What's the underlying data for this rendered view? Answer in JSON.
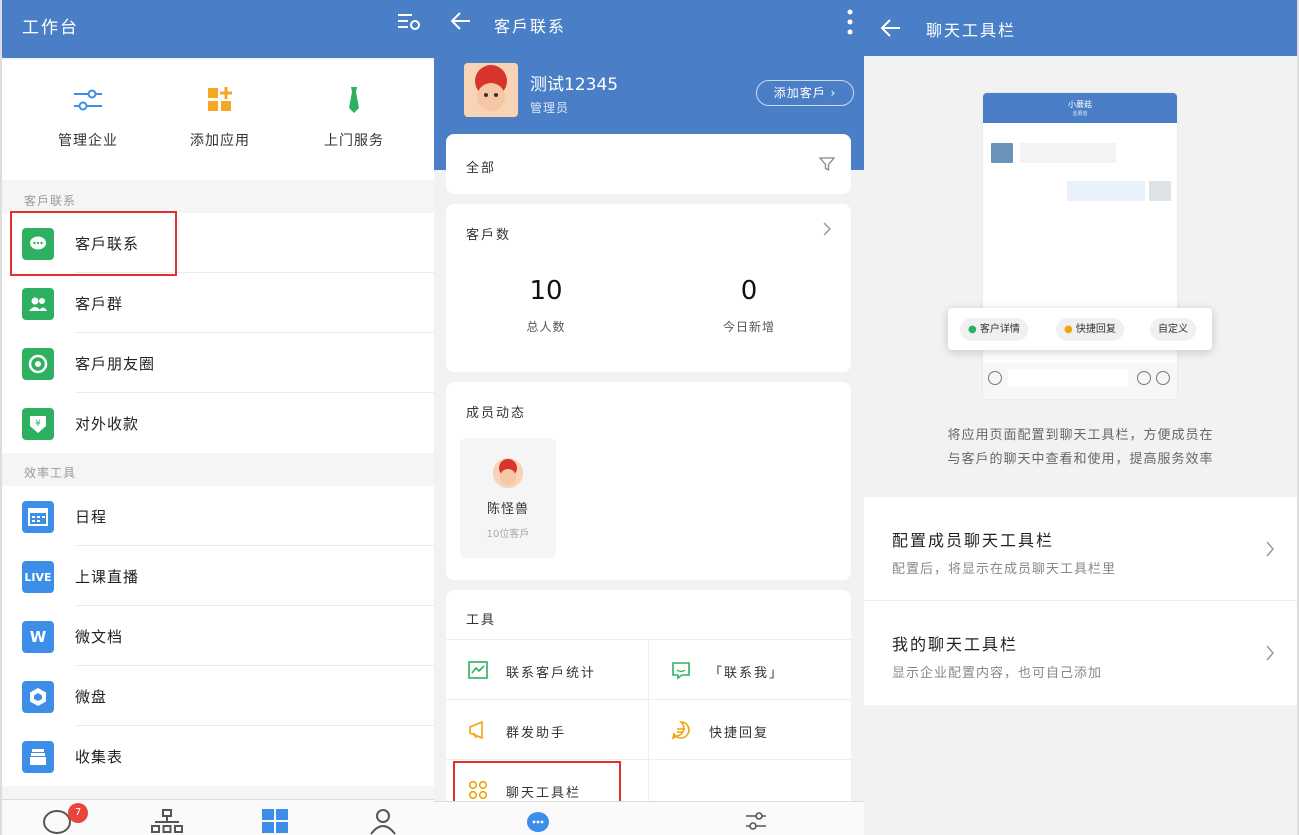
{
  "colors": {
    "header_blue": "#4a7fc7",
    "green": "#2db160",
    "blue": "#3d8ee8",
    "highlight_red": "#e22f2f"
  },
  "panel1": {
    "title": "工作台",
    "quick_items": [
      {
        "label": "管理企业",
        "icon": "sliders-icon"
      },
      {
        "label": "添加应用",
        "icon": "add-app-icon"
      },
      {
        "label": "上门服务",
        "icon": "tie-icon"
      }
    ],
    "section_customer": "客戶联系",
    "customer_items": [
      {
        "label": "客戶联系",
        "icon": "chat-bubble-icon"
      },
      {
        "label": "客戶群",
        "icon": "group-icon"
      },
      {
        "label": "客戶朋友圈",
        "icon": "aperture-icon"
      },
      {
        "label": "对外收款",
        "icon": "yen-shield-icon"
      }
    ],
    "section_efficiency": "效率工具",
    "efficiency_items": [
      {
        "label": "日程",
        "icon": "calendar-icon"
      },
      {
        "label": "上课直播",
        "icon": "live-icon",
        "badge_text": "LIVE"
      },
      {
        "label": "微文档",
        "icon": "doc-icon",
        "badge_text": "W"
      },
      {
        "label": "微盘",
        "icon": "disk-icon"
      },
      {
        "label": "收集表",
        "icon": "form-icon"
      }
    ],
    "nav_badge": "7"
  },
  "panel2": {
    "title": "客戶联系",
    "user_name": "测试12345",
    "user_role": "管理员",
    "add_customer": "添加客戶 ›",
    "filter_label": "全部",
    "count_card": {
      "title": "客戶数",
      "total_value": "10",
      "total_label": "总人数",
      "today_value": "0",
      "today_label": "今日新增"
    },
    "member_card": {
      "title": "成员动态",
      "member_name": "陈怪兽",
      "member_count": "10位客戶"
    },
    "tools_card": {
      "title": "工具",
      "items": [
        {
          "label": "联系客戶统计",
          "icon": "trend-chart-icon"
        },
        {
          "label": "「联系我」",
          "icon": "message-box-icon"
        },
        {
          "label": "群发助手",
          "icon": "megaphone-icon"
        },
        {
          "label": "快捷回复",
          "icon": "quick-reply-icon"
        },
        {
          "label": "聊天工具栏",
          "icon": "toolbar-grid-icon"
        }
      ]
    }
  },
  "panel3": {
    "title": "聊天工具栏",
    "preview": {
      "chat_title": "小蘑菇",
      "chat_sub": "金蘑菇",
      "pill_details": "客户详情",
      "pill_quick": "快捷回复",
      "pill_custom": "自定义"
    },
    "description_line1": "将应用页面配置到聊天工具栏，方便成员在",
    "description_line2": "与客戶的聊天中查看和使用，提高服务效率",
    "options": [
      {
        "title": "配置成员聊天工具栏",
        "subtitle": "配置后，将显示在成员聊天工具栏里"
      },
      {
        "title": "我的聊天工具栏",
        "subtitle": "显示企业配置内容，也可自己添加"
      }
    ]
  }
}
